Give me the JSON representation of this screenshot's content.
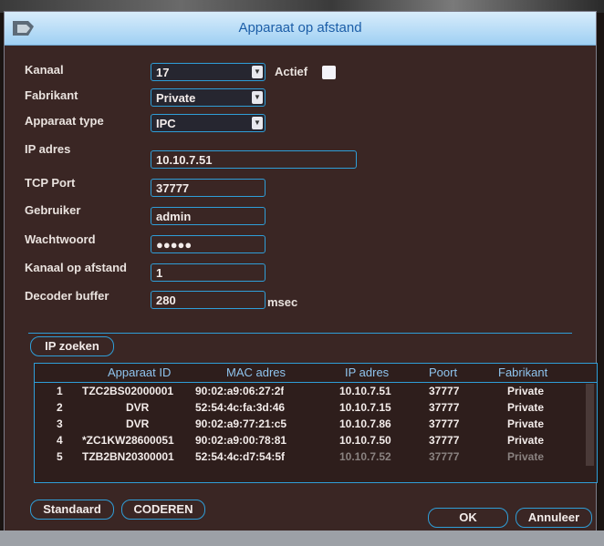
{
  "dialog": {
    "title": "Apparaat op afstand"
  },
  "form": {
    "kanaal_label": "Kanaal",
    "kanaal_value": "17",
    "actief_label": "Actief",
    "fabrikant_label": "Fabrikant",
    "fabrikant_value": "Private",
    "apparaat_type_label": "Apparaat type",
    "apparaat_type_value": "IPC",
    "ip_label": "IP adres",
    "ip_value": "10.10.7.51",
    "tcp_label": "TCP Port",
    "tcp_value": "37777",
    "gebruiker_label": "Gebruiker",
    "gebruiker_value": "admin",
    "wachtwoord_label": "Wachtwoord",
    "wachtwoord_value": "●●●●●",
    "kanaal_afstand_label": "Kanaal op afstand",
    "kanaal_afstand_value": "1",
    "decoder_label": "Decoder buffer",
    "decoder_value": "280",
    "decoder_unit": "msec"
  },
  "search": {
    "button_label": "IP zoeken"
  },
  "table": {
    "headers": [
      "",
      "Apparaat ID",
      "MAC adres",
      "IP adres",
      "Poort",
      "Fabrikant"
    ],
    "rows": [
      [
        "1",
        "TZC2BS02000001",
        "90:02:a9:06:27:2f",
        "10.10.7.51",
        "37777",
        "Private"
      ],
      [
        "2",
        "DVR",
        "52:54:4c:fa:3d:46",
        "10.10.7.15",
        "37777",
        "Private"
      ],
      [
        "3",
        "DVR",
        "90:02:a9:77:21:c5",
        "10.10.7.86",
        "37777",
        "Private"
      ],
      [
        "4",
        "*ZC1KW28600051",
        "90:02:a9:00:78:81",
        "10.10.7.50",
        "37777",
        "Private"
      ],
      [
        "5",
        "TZB2BN20300001",
        "52:54:4c:d7:54:5f",
        "10.10.7.52",
        "37777",
        "Private"
      ]
    ]
  },
  "footer": {
    "standaard_label": "Standaard",
    "coderen_label": "CODEREN",
    "ok_label": "OK",
    "annuleer_label": "Annuleer"
  },
  "colors": {
    "accent": "#2f9ed8",
    "background": "#3a2624",
    "title_bar": "#b5def7",
    "title_text": "#1c5ea8"
  },
  "icons": {
    "title_logo": "camera-logo-icon",
    "dropdown": "dropdown-arrow-icon"
  }
}
